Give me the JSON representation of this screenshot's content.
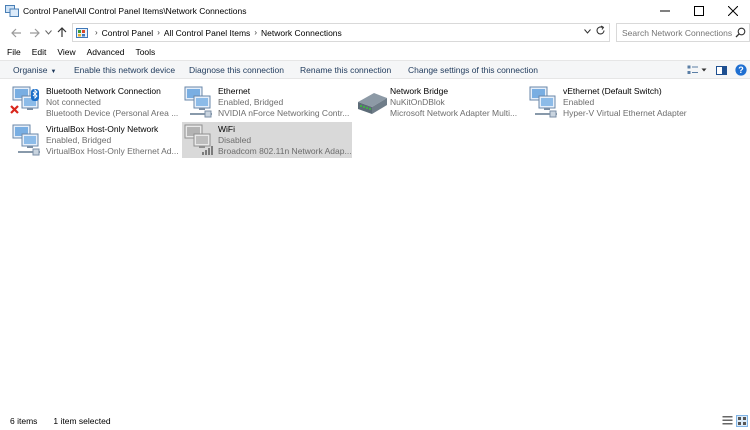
{
  "window": {
    "title": "Control Panel\\All Control Panel Items\\Network Connections"
  },
  "address": {
    "crumbs": [
      "Control Panel",
      "All Control Panel Items",
      "Network Connections"
    ],
    "search_placeholder": "Search Network Connections"
  },
  "menu": [
    "File",
    "Edit",
    "View",
    "Advanced",
    "Tools"
  ],
  "commands": {
    "organise": "Organise",
    "enable": "Enable this network device",
    "diagnose": "Diagnose this connection",
    "rename": "Rename this connection",
    "change_settings": "Change settings of this connection"
  },
  "items": [
    {
      "name": "Bluetooth Network Connection",
      "status": "Not connected",
      "device": "Bluetooth Device (Personal Area ...",
      "icon": "bluetooth-network-icon"
    },
    {
      "name": "Ethernet",
      "status": "Enabled, Bridged",
      "device": "NVIDIA nForce Networking Contr...",
      "icon": "ethernet-network-icon"
    },
    {
      "name": "Network Bridge",
      "status": "NuKitOnDBlok",
      "device": "Microsoft Network Adapter Multi...",
      "icon": "network-bridge-icon"
    },
    {
      "name": "vEthernet (Default Switch)",
      "status": "Enabled",
      "device": "Hyper-V Virtual Ethernet Adapter",
      "icon": "vethernet-network-icon"
    },
    {
      "name": "VirtualBox Host-Only Network",
      "status": "Enabled, Bridged",
      "device": "VirtualBox Host-Only Ethernet Ad...",
      "icon": "virtualbox-network-icon"
    },
    {
      "name": "WiFi",
      "status": "Disabled",
      "device": "Broadcom 802.11n Network Adap...",
      "icon": "wifi-network-icon",
      "selected": true
    }
  ],
  "status": {
    "count": "6 items",
    "selected": "1 item selected"
  },
  "colors": {
    "command_text": "#1e395b",
    "selected_bg": "#d9d9d9",
    "sub_text": "#6d6d6d",
    "error_red": "#d9261c",
    "bluetooth_blue": "#1a6fc9"
  }
}
